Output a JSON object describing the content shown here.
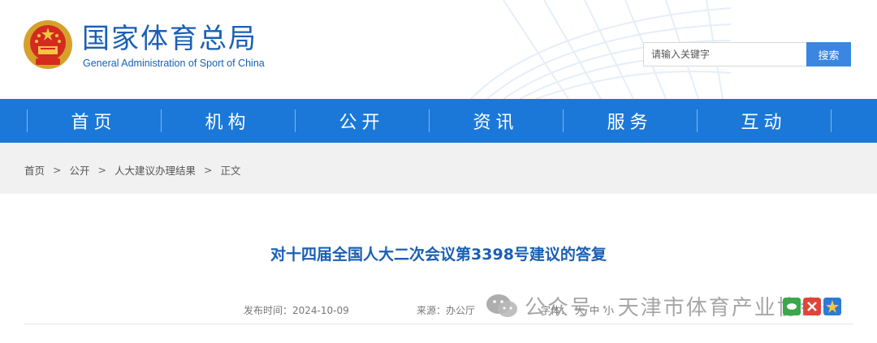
{
  "header": {
    "title": "国家体育总局",
    "subtitle": "General Administration of Sport of China",
    "search_placeholder": "请输入关键字",
    "search_button": "搜索"
  },
  "nav": {
    "items": [
      {
        "label": "首页"
      },
      {
        "label": "机构"
      },
      {
        "label": "公开"
      },
      {
        "label": "资讯"
      },
      {
        "label": "服务"
      },
      {
        "label": "互动"
      }
    ]
  },
  "breadcrumb": {
    "items": [
      "首页",
      "公开",
      "人大建议办理结果",
      "正文"
    ],
    "separator": ">"
  },
  "article": {
    "title": "对十四届全国人大二次会议第3398号建议的答复",
    "date_label": "发布时间：",
    "date": "2024-10-09",
    "source": "来源：办公厅",
    "font_label": "字体：",
    "font_large": "大",
    "font_medium": "中",
    "font_small": "小"
  },
  "watermark": {
    "text": "公众号 · 天津市体育产业协会",
    "icon": "wechat-icon"
  },
  "colors": {
    "brand_blue": "#1a5fb4",
    "nav_blue": "#1b78d8",
    "search_button": "#3a86e0",
    "crumb_bg": "#f1f1f1"
  }
}
